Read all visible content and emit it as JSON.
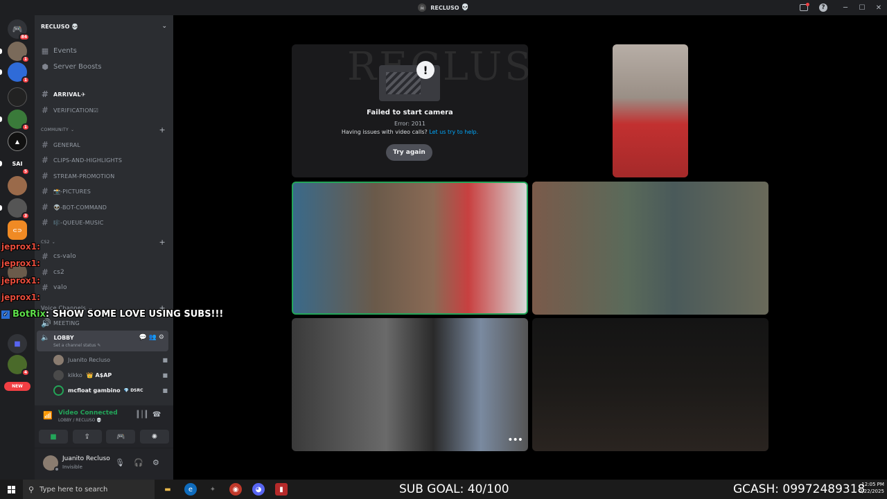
{
  "window": {
    "title": "RECLUSO",
    "title_emoji": "💀"
  },
  "rail": {
    "home_badge": "84",
    "servers": [
      {
        "badge": "1"
      },
      {
        "badge": "1"
      },
      {
        "badge": ""
      },
      {
        "badge": "1"
      },
      {
        "badge": ""
      },
      {
        "label": "SAI",
        "badge": "5"
      },
      {
        "badge": ""
      },
      {
        "badge": "3"
      },
      {
        "badge": ""
      },
      {
        "badge": "3"
      },
      {
        "badge": ""
      },
      {
        "badge": "4"
      }
    ],
    "new_label": "NEW"
  },
  "sidebar": {
    "server_name": "RECLUSO",
    "server_emoji": "💀",
    "top_items": [
      {
        "label": "Events"
      },
      {
        "label": "Server Boosts"
      }
    ],
    "channels_top": [
      {
        "label": "ARRIVAL✈"
      },
      {
        "label": "VERIFICATION☑"
      }
    ],
    "category_community": "COMMUNITY",
    "community_channels": [
      {
        "label": "GENERAL"
      },
      {
        "label": "CLIPS-AND-HIGHLIGHTS"
      },
      {
        "label": "STREAM-PROMOTION"
      },
      {
        "label": "📸-PICTURES"
      },
      {
        "label": "👽-BOT-COMMAND"
      },
      {
        "label": "🎼-QUEUE-MUSIC"
      }
    ],
    "category_cs2": "CS2",
    "cs2_channels": [
      {
        "label": "cs-valo"
      },
      {
        "label": "cs2"
      },
      {
        "label": "valo"
      }
    ],
    "category_voice": "Voice Channels",
    "voice_meeting": "MEETING",
    "lobby": {
      "label": "LOBBY",
      "status": "Set a channel status"
    },
    "voice_users": [
      {
        "name": "Juanito Recluso"
      },
      {
        "name": "kikko",
        "tag": "A$AP"
      },
      {
        "name": "mcfloat gambino",
        "tag": "DSRC"
      }
    ]
  },
  "voice_panel": {
    "title": "Video Connected",
    "subtitle": "LOBBY / RECLUSO 💀"
  },
  "user_panel": {
    "name": "Juanito Recluso",
    "status": "Invisible"
  },
  "stage": {
    "error_tile": {
      "title": "Failed to start camera",
      "code": "Error: 2011",
      "help_text": "Having issues with video calls?",
      "help_link": "Let us try to help.",
      "button": "Try again"
    }
  },
  "overlays": {
    "chat_names": [
      "jeprox1:",
      "jeprox1:",
      "jeprox1:",
      "jeprox1:"
    ],
    "bot_name": "BotRix",
    "bot_message": ": SHOW SOME LOVE USING SUBS!!!"
  },
  "taskbar": {
    "search_placeholder": "Type here to search",
    "sub_goal": "SUB GOAL: 40/100",
    "gcash": "GCASH: 09972489318",
    "time": "12:05 PM",
    "date": "2/22/2025"
  }
}
